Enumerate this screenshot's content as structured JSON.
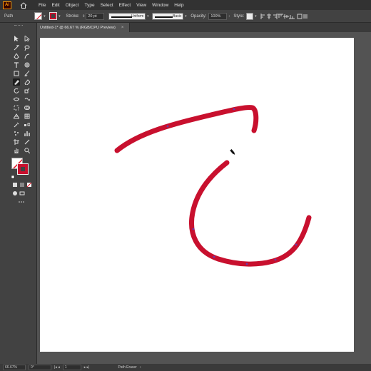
{
  "app": {
    "logo": "Ai"
  },
  "menu": [
    "File",
    "Edit",
    "Object",
    "Type",
    "Select",
    "Effect",
    "View",
    "Window",
    "Help"
  ],
  "control": {
    "selection_label": "Path",
    "stroke_label": "Stroke:",
    "stroke_weight": "20 pt",
    "variable_width": "Uniform",
    "brush": "Basic",
    "opacity_label": "Opacity:",
    "opacity_value": "100%",
    "style_label": "Style:"
  },
  "document": {
    "tab_title": "Untitled-1* @ 66.67 % (RGB/CPU Preview)",
    "close": "×"
  },
  "status": {
    "zoom": "66.67%",
    "rotation": "0°",
    "artboard": "1",
    "tool_name": "Path Eraser"
  },
  "colors": {
    "stroke": "#c8102e",
    "anchor": "#6a3aa8",
    "artboard": "#ffffff",
    "workspace": "#535353"
  },
  "paths": [
    {
      "name": "upper-stroke",
      "points": "curve from left end up-right to a hook at right"
    },
    {
      "name": "lower-stroke",
      "points": "U-shaped curve"
    }
  ]
}
